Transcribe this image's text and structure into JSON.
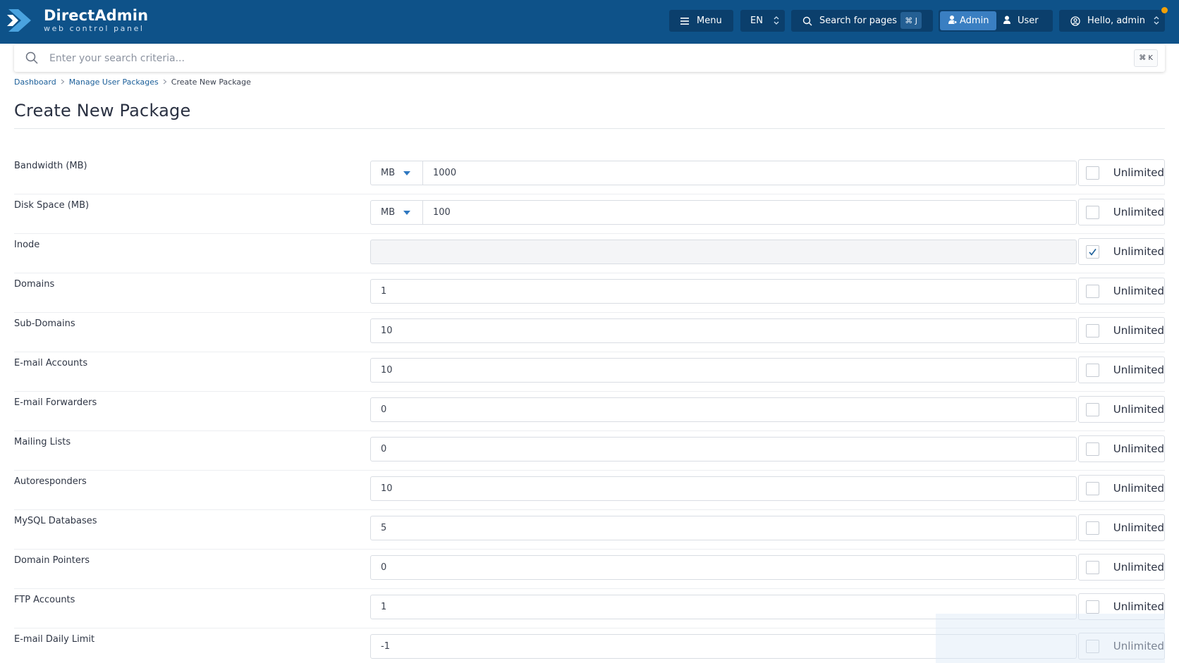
{
  "brand": {
    "title": "DirectAdmin",
    "subtitle": "web control panel",
    "colors": {
      "header": "#0e5289",
      "accent": "#3a7fc2",
      "notification": "#f2a007"
    }
  },
  "header": {
    "menu_label": "Menu",
    "menu_icon": "hamburger-icon",
    "language": "EN",
    "search_pages_label": "Search for pages",
    "search_pages_shortcut": "⌘ J",
    "role_admin": "Admin",
    "role_user": "User",
    "greeting": "Hello, admin"
  },
  "search": {
    "placeholder": "Enter your search criteria...",
    "shortcut": "⌘ K"
  },
  "breadcrumb": {
    "items": [
      "Dashboard",
      "Manage User Packages",
      "Create New Package"
    ]
  },
  "page": {
    "title": "Create New Package"
  },
  "form": {
    "unlimited_label": "Unlimited",
    "rows": [
      {
        "label": "Bandwidth (MB)",
        "unit": "MB",
        "value": "1000",
        "unlimited": false
      },
      {
        "label": "Disk Space (MB)",
        "unit": "MB",
        "value": "100",
        "unlimited": false
      },
      {
        "label": "Inode",
        "value": "",
        "unlimited": true
      },
      {
        "label": "Domains",
        "value": "1",
        "unlimited": false
      },
      {
        "label": "Sub-Domains",
        "value": "10",
        "unlimited": false
      },
      {
        "label": "E-mail Accounts",
        "value": "10",
        "unlimited": false
      },
      {
        "label": "E-mail Forwarders",
        "value": "0",
        "unlimited": false
      },
      {
        "label": "Mailing Lists",
        "value": "0",
        "unlimited": false
      },
      {
        "label": "Autoresponders",
        "value": "10",
        "unlimited": false
      },
      {
        "label": "MySQL Databases",
        "value": "5",
        "unlimited": false
      },
      {
        "label": "Domain Pointers",
        "value": "0",
        "unlimited": false
      },
      {
        "label": "FTP Accounts",
        "value": "1",
        "unlimited": false
      },
      {
        "label": "E-mail Daily Limit",
        "value": "-1",
        "unlimited": false
      }
    ]
  }
}
